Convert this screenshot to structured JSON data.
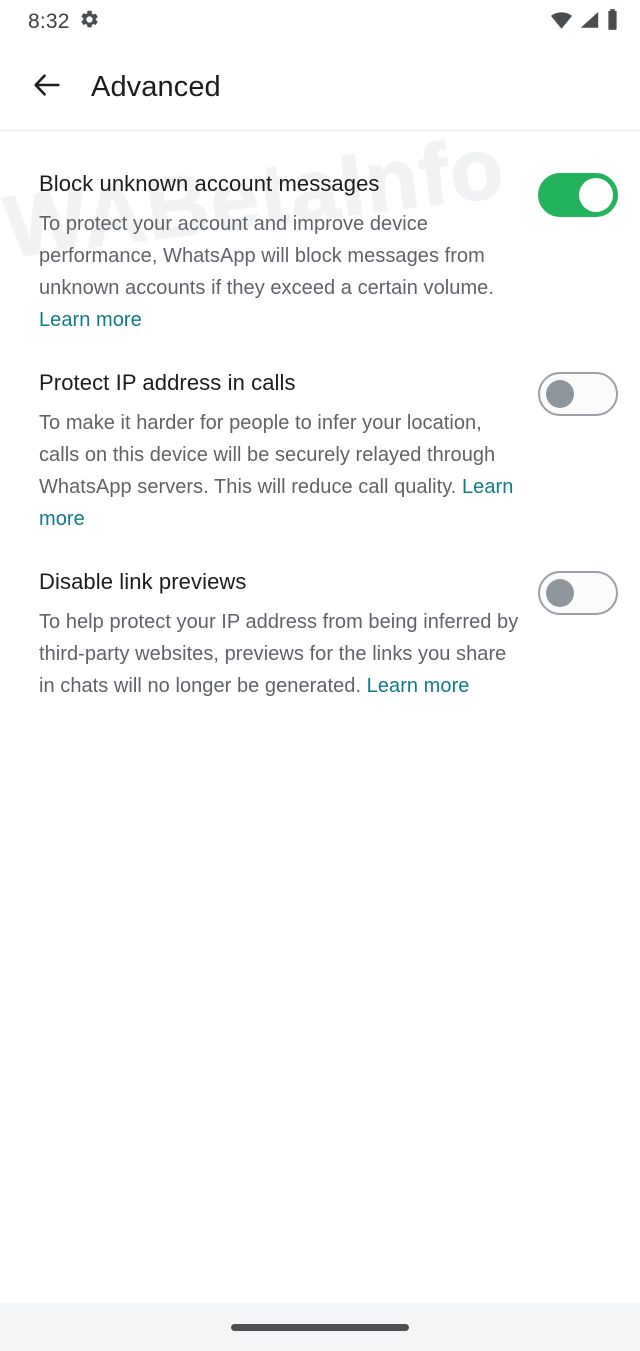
{
  "status_bar": {
    "time": "8:32",
    "gear_icon": "gear-icon",
    "wifi_icon": "wifi-icon",
    "signal_icon": "cellular-signal-icon",
    "battery_icon": "battery-full-icon"
  },
  "header": {
    "back_icon": "back-arrow-icon",
    "title": "Advanced"
  },
  "watermark": {
    "text": "WABetaInfo"
  },
  "colors": {
    "toggle_on": "#22b35c",
    "toggle_off_border": "#9aa0a6",
    "toggle_off_thumb": "#8f959c",
    "link": "#0f7b8a",
    "title_text": "#1b1c1e",
    "body_text": "#5f6368",
    "navbar_bg": "#f4f5f7"
  },
  "settings": [
    {
      "title": "Block unknown account messages",
      "description": "To protect your account and improve device performance, WhatsApp will block messages from unknown accounts if they exceed a certain volume. ",
      "link_label": "Learn more",
      "toggle_state": "on"
    },
    {
      "title": "Protect IP address in calls",
      "description": "To make it harder for people to infer your location, calls on this device will be securely relayed through WhatsApp servers. This will reduce call quality. ",
      "link_label": "Learn more",
      "toggle_state": "off"
    },
    {
      "title": "Disable link previews",
      "description": "To help protect your IP address from being inferred by third-party websites, previews for the links you share in chats will no longer be generated. ",
      "link_label": "Learn more",
      "toggle_state": "off"
    }
  ],
  "nav_bar": {
    "home_indicator": "home-indicator"
  }
}
